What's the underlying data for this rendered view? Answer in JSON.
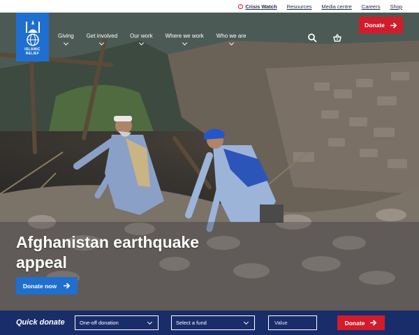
{
  "utility": {
    "crisis_watch": "Crisis Watch",
    "links": [
      "Resources",
      "Media centre",
      "Careers",
      "Shop"
    ]
  },
  "brand": {
    "logo_text_1": "ISLAMIC",
    "logo_text_2": "RELIEF",
    "color": "#1f6fd0"
  },
  "nav": {
    "items": [
      "Giving",
      "Get involved",
      "Our work",
      "Where we work",
      "Who we are"
    ],
    "icons": [
      "search-icon",
      "basket-icon"
    ],
    "donate_label": "Donate"
  },
  "hero": {
    "title_line_1": "Afghanistan earthquake",
    "title_line_2": "appeal",
    "cta_label": "Donate now"
  },
  "quick_donate": {
    "title": "Quick donate",
    "frequency": "One-off donation",
    "fund": "Select a fund",
    "value_placeholder": "Value",
    "donate_label": "Donate"
  },
  "colors": {
    "accent_red": "#d21c2b",
    "brand_blue": "#1f6fd0",
    "bar_navy": "#1a2d6b"
  }
}
